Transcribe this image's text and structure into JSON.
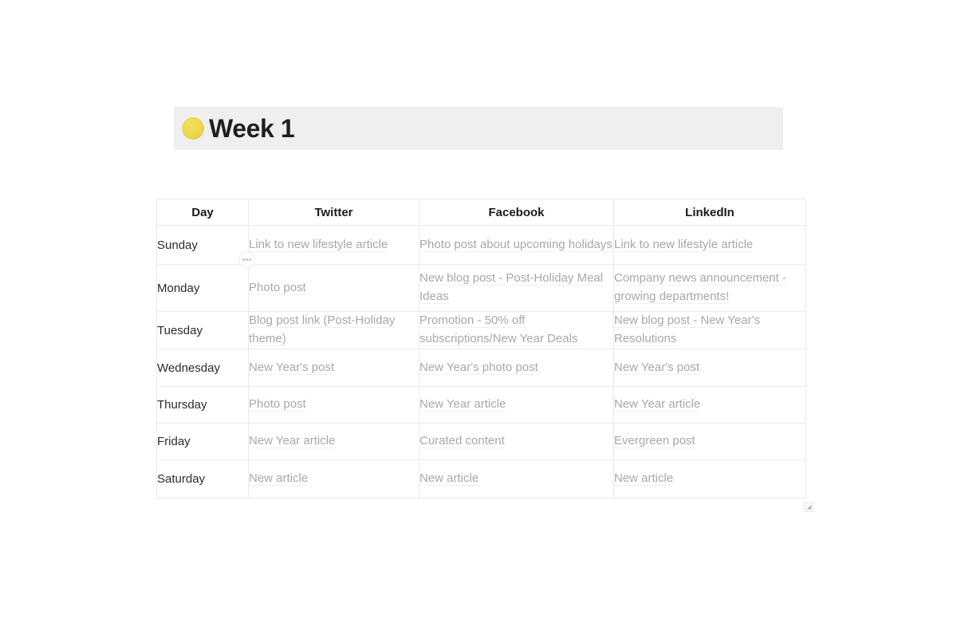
{
  "page": {
    "background": "#ffffff",
    "accent_yellow": "#ecd94e",
    "banner_background": "#efefef",
    "cell_text_color": "#a8a8a8",
    "header_text_color": "#1a1a1a",
    "border_color": "#eaeaea"
  },
  "banner": {
    "emoji_name": "yellow-circle-emoji",
    "title": "Week 1"
  },
  "table": {
    "columns": [
      "Day",
      "Twitter",
      "Facebook",
      "LinkedIn"
    ],
    "rows": [
      {
        "day": "Sunday",
        "twitter": "Link to new lifestyle article",
        "facebook": "Photo post about upcoming holidays",
        "linkedin": "Link to new lifestyle article"
      },
      {
        "day": "Monday",
        "twitter": "Photo post",
        "facebook": "New blog post - Post-Holiday Meal Ideas",
        "linkedin": "Company news announcement - growing departments!"
      },
      {
        "day": "Tuesday",
        "twitter": "Blog post link (Post-Holiday theme)",
        "facebook": "Promotion - 50% off subscriptions/New Year Deals",
        "linkedin": "New blog post - New Year's Resolutions"
      },
      {
        "day": "Wednesday",
        "twitter": "New Year's post",
        "facebook": "New Year's photo post",
        "linkedin": "New Year's post"
      },
      {
        "day": "Thursday",
        "twitter": "Photo post",
        "facebook": "New Year article",
        "linkedin": "New Year article"
      },
      {
        "day": "Friday",
        "twitter": "New Year article",
        "facebook": "Curated content",
        "linkedin": "Evergreen post"
      },
      {
        "day": "Saturday",
        "twitter": "New article",
        "facebook": "New article",
        "linkedin": "New article"
      }
    ]
  },
  "controls": {
    "drag_handle_icon": "ellipsis-handle-icon",
    "resize_handle_icon": "resize-corner-icon"
  }
}
